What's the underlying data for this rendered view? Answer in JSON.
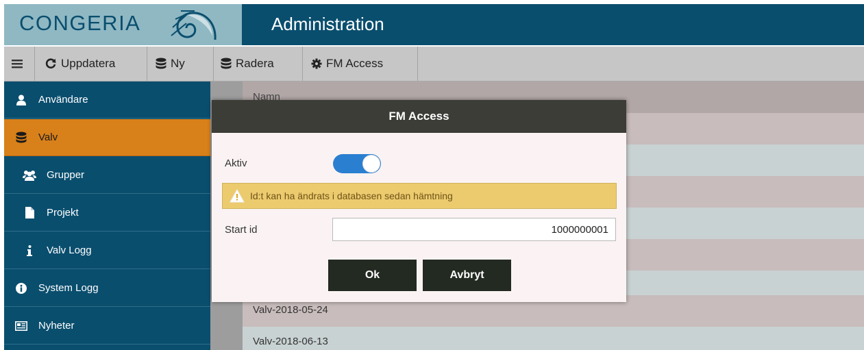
{
  "header": {
    "logo_text": "CONGERIA",
    "title": "Administration",
    "colors": {
      "header_bg": "#0a4e6e",
      "logo_bg": "#8fb8c3"
    }
  },
  "toolbar": {
    "menu_icon": "hamburger-icon",
    "refresh_label": "Uppdatera",
    "new_label": "Ny",
    "delete_label": "Radera",
    "fm_access_label": "FM Access"
  },
  "sidebar": {
    "items": [
      {
        "label": "Användare",
        "icon": "user-icon",
        "active": false
      },
      {
        "label": "Valv",
        "icon": "database-icon",
        "active": true
      },
      {
        "label": "Grupper",
        "icon": "users-icon",
        "active": false
      },
      {
        "label": "Projekt",
        "icon": "file-icon",
        "active": false
      },
      {
        "label": "Valv Logg",
        "icon": "info-icon",
        "active": false
      },
      {
        "label": "System Logg",
        "icon": "info-circle-icon",
        "active": false
      },
      {
        "label": "Nyheter",
        "icon": "newspaper-icon",
        "active": false
      }
    ],
    "active_color": "#d8801a"
  },
  "table": {
    "column_header": "Namn",
    "rows": [
      "Valv-2018-05-24",
      "Valv-2018-06-13"
    ]
  },
  "modal": {
    "title": "FM Access",
    "active_label": "Aktiv",
    "active_on": true,
    "warning": "Id:t kan ha ändrats i databasen sedan hämtning",
    "start_id_label": "Start id",
    "start_id_value": "1000000001",
    "ok_label": "Ok",
    "cancel_label": "Avbryt"
  }
}
